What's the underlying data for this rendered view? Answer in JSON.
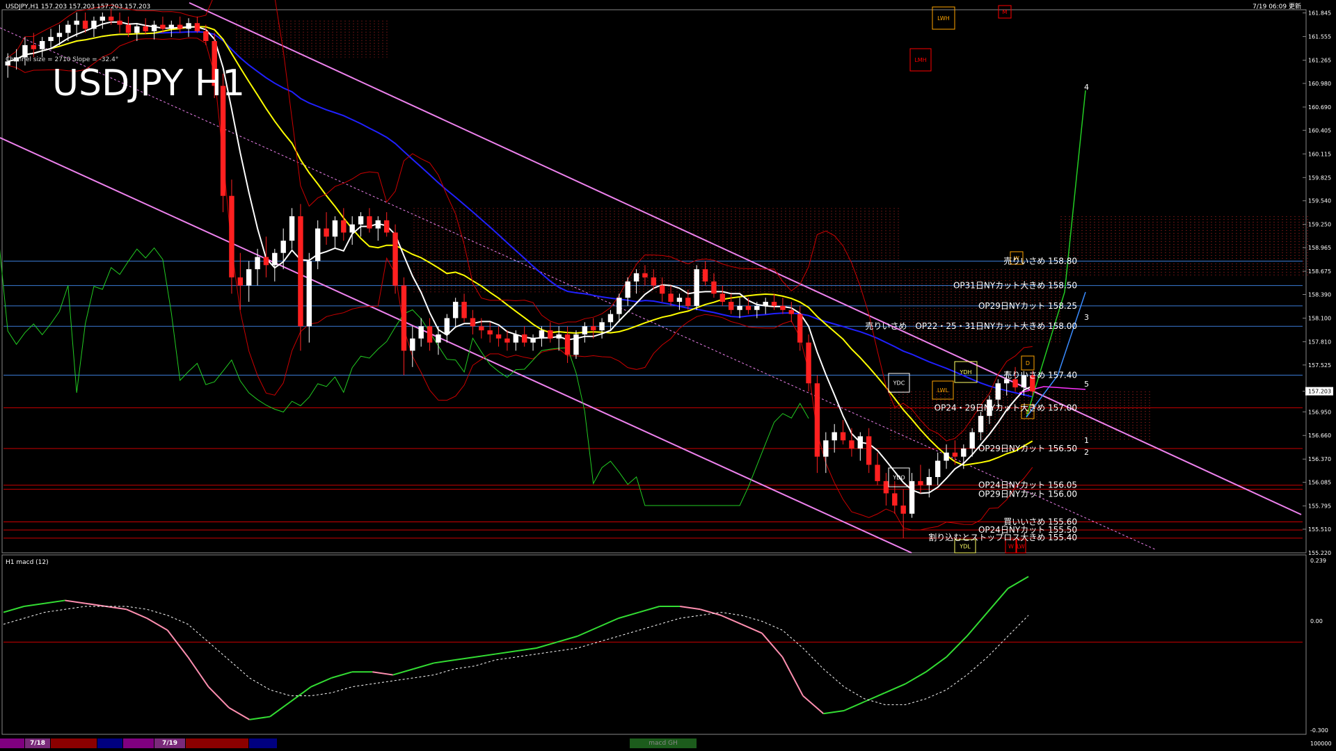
{
  "header": {
    "symbol_info": "USDJPY,H1  157.203 157.203 157.203 157.203",
    "server_time": "7/19 06:09 更新",
    "big_title": "USDJPY H1",
    "channel_info": "Channel size = 2710 Slope = -32.4°"
  },
  "colors": {
    "bull": "#ffffff",
    "bear": "#ff2020",
    "channel": "#ee82ee",
    "kumo": "#ff3030",
    "ma_white": "#ffffff",
    "ma_yellow": "#ffff00",
    "ma_blue": "#2020ff",
    "macd_main": "#33dd33",
    "macd_signal": "#ffffff",
    "level_blue": "#3a7bd5",
    "level_red": "#cc0000"
  },
  "price_axis": {
    "ticks": [
      "161.845",
      "161.555",
      "161.265",
      "160.980",
      "160.690",
      "160.405",
      "160.115",
      "159.825",
      "159.540",
      "159.250",
      "158.965",
      "158.675",
      "158.390",
      "158.100",
      "157.810",
      "157.525",
      "157.203",
      "156.950",
      "156.660",
      "156.370",
      "156.085",
      "155.795",
      "155.510",
      "155.220"
    ],
    "current": "157.203"
  },
  "level_labels": [
    "売りいさめ 158.80",
    "OP31日NYカット大きめ 158.50",
    "OP29日NYカット 158.25",
    "売りいさめ　OP22・25・31日NYカット大きめ 158.00",
    "売りいさめ 157.40",
    "OP24・29日NYカット大きめ 157.00",
    "OP29日NYカット 156.50",
    "OP24日NYカット 156.05",
    "OP29日NYカット 156.00",
    "買いいさめ 155.60",
    "OP24日NYカット 155.50",
    "割り込むとストップロス大きめ 155.40"
  ],
  "box_labels": [
    "LWH",
    "M",
    "LMH",
    "YDC",
    "YDH",
    "LWL",
    "D",
    "D",
    "YDO",
    "YDL",
    "W",
    "W",
    "LW"
  ],
  "wave_labels": [
    "4",
    "3",
    "5",
    "1",
    "2"
  ],
  "macd": {
    "title": "H1  macd (12)",
    "scale_top": "0.239",
    "scale_zero": "0.00",
    "scale_bottom": "-0.300",
    "footer": "100000"
  },
  "date_tabs": [
    "7/18",
    "7/19"
  ],
  "bottom_label": "macd GH",
  "chart_data": {
    "type": "candlestick",
    "symbol": "USDJPY",
    "timeframe": "H1",
    "ylim": [
      155.22,
      161.85
    ],
    "candles": [
      [
        161.2,
        161.35,
        161.05,
        161.25
      ],
      [
        161.25,
        161.4,
        161.15,
        161.3
      ],
      [
        161.3,
        161.55,
        161.2,
        161.45
      ],
      [
        161.45,
        161.6,
        161.3,
        161.4
      ],
      [
        161.4,
        161.55,
        161.3,
        161.5
      ],
      [
        161.5,
        161.65,
        161.4,
        161.55
      ],
      [
        161.55,
        161.7,
        161.45,
        161.6
      ],
      [
        161.6,
        161.75,
        161.5,
        161.7
      ],
      [
        161.7,
        161.85,
        161.55,
        161.75
      ],
      [
        161.75,
        161.85,
        161.6,
        161.65
      ],
      [
        161.65,
        161.8,
        161.55,
        161.75
      ],
      [
        161.75,
        161.85,
        161.65,
        161.8
      ],
      [
        161.8,
        161.9,
        161.7,
        161.75
      ],
      [
        161.75,
        161.85,
        161.6,
        161.7
      ],
      [
        161.7,
        161.8,
        161.55,
        161.6
      ],
      [
        161.6,
        161.72,
        161.5,
        161.68
      ],
      [
        161.68,
        161.78,
        161.58,
        161.62
      ],
      [
        161.62,
        161.75,
        161.52,
        161.7
      ],
      [
        161.7,
        161.8,
        161.6,
        161.65
      ],
      [
        161.65,
        161.75,
        161.55,
        161.7
      ],
      [
        161.7,
        161.8,
        161.6,
        161.65
      ],
      [
        161.65,
        161.78,
        161.55,
        161.72
      ],
      [
        161.72,
        161.8,
        161.6,
        161.62
      ],
      [
        161.62,
        161.7,
        161.45,
        161.5
      ],
      [
        161.5,
        161.6,
        160.8,
        160.95
      ],
      [
        160.95,
        161.1,
        159.4,
        159.6
      ],
      [
        159.6,
        159.8,
        158.4,
        158.6
      ],
      [
        158.6,
        158.9,
        158.2,
        158.5
      ],
      [
        158.5,
        158.8,
        158.3,
        158.7
      ],
      [
        158.7,
        158.95,
        158.5,
        158.85
      ],
      [
        158.85,
        159.1,
        158.6,
        158.75
      ],
      [
        158.75,
        158.95,
        158.55,
        158.9
      ],
      [
        158.9,
        159.2,
        158.7,
        159.05
      ],
      [
        159.05,
        159.45,
        158.95,
        159.35
      ],
      [
        159.35,
        159.5,
        157.7,
        158.0
      ],
      [
        158.0,
        158.9,
        157.8,
        158.8
      ],
      [
        158.8,
        159.3,
        158.7,
        159.2
      ],
      [
        159.2,
        159.4,
        159.0,
        159.1
      ],
      [
        159.1,
        159.35,
        158.95,
        159.3
      ],
      [
        159.3,
        159.45,
        159.05,
        159.15
      ],
      [
        159.15,
        159.35,
        159.0,
        159.25
      ],
      [
        159.25,
        159.4,
        159.1,
        159.35
      ],
      [
        159.35,
        159.45,
        159.15,
        159.2
      ],
      [
        159.2,
        159.35,
        159.05,
        159.3
      ],
      [
        159.3,
        159.4,
        159.1,
        159.15
      ],
      [
        159.15,
        159.25,
        158.4,
        158.5
      ],
      [
        158.5,
        158.6,
        157.4,
        157.7
      ],
      [
        157.7,
        158.0,
        157.5,
        157.85
      ],
      [
        157.85,
        158.1,
        157.75,
        158.0
      ],
      [
        158.0,
        158.1,
        157.7,
        157.8
      ],
      [
        157.8,
        158.0,
        157.65,
        157.9
      ],
      [
        157.9,
        158.15,
        157.8,
        158.1
      ],
      [
        158.1,
        158.35,
        158.0,
        158.3
      ],
      [
        158.3,
        158.4,
        158.05,
        158.1
      ],
      [
        158.1,
        158.2,
        157.9,
        158.0
      ],
      [
        158.0,
        158.1,
        157.85,
        157.95
      ],
      [
        157.95,
        158.05,
        157.8,
        157.9
      ],
      [
        157.9,
        158.0,
        157.75,
        157.85
      ],
      [
        157.85,
        157.95,
        157.7,
        157.8
      ],
      [
        157.8,
        157.95,
        157.7,
        157.9
      ],
      [
        157.9,
        158.0,
        157.75,
        157.8
      ],
      [
        157.8,
        157.9,
        157.7,
        157.85
      ],
      [
        157.85,
        158.0,
        157.75,
        157.95
      ],
      [
        157.95,
        158.05,
        157.8,
        157.85
      ],
      [
        157.85,
        158.0,
        157.7,
        157.9
      ],
      [
        157.9,
        158.0,
        157.55,
        157.65
      ],
      [
        157.65,
        157.95,
        157.6,
        157.9
      ],
      [
        157.9,
        158.05,
        157.8,
        158.0
      ],
      [
        158.0,
        158.1,
        157.85,
        157.95
      ],
      [
        157.95,
        158.1,
        157.85,
        158.05
      ],
      [
        158.05,
        158.2,
        157.95,
        158.15
      ],
      [
        158.15,
        158.4,
        158.05,
        158.35
      ],
      [
        158.35,
        158.6,
        158.25,
        158.55
      ],
      [
        158.55,
        158.7,
        158.4,
        158.65
      ],
      [
        158.65,
        158.75,
        158.5,
        158.6
      ],
      [
        158.6,
        158.7,
        158.45,
        158.5
      ],
      [
        158.5,
        158.6,
        158.3,
        158.4
      ],
      [
        158.4,
        158.5,
        158.25,
        158.3
      ],
      [
        158.3,
        158.4,
        158.2,
        158.35
      ],
      [
        158.35,
        158.45,
        158.2,
        158.25
      ],
      [
        158.25,
        158.75,
        158.2,
        158.7
      ],
      [
        158.7,
        158.8,
        158.5,
        158.55
      ],
      [
        158.55,
        158.65,
        158.35,
        158.4
      ],
      [
        158.4,
        158.5,
        158.25,
        158.3
      ],
      [
        158.3,
        158.4,
        158.15,
        158.2
      ],
      [
        158.2,
        158.35,
        158.1,
        158.25
      ],
      [
        158.25,
        158.35,
        158.15,
        158.2
      ],
      [
        158.2,
        158.3,
        158.1,
        158.25
      ],
      [
        158.25,
        158.35,
        158.15,
        158.3
      ],
      [
        158.3,
        158.4,
        158.2,
        158.25
      ],
      [
        158.25,
        158.35,
        158.15,
        158.2
      ],
      [
        158.2,
        158.3,
        158.05,
        158.15
      ],
      [
        158.15,
        158.25,
        157.7,
        157.8
      ],
      [
        157.8,
        157.9,
        157.2,
        157.3
      ],
      [
        157.3,
        157.4,
        156.2,
        156.4
      ],
      [
        156.4,
        156.7,
        156.2,
        156.6
      ],
      [
        156.6,
        156.8,
        156.45,
        156.7
      ],
      [
        156.7,
        156.85,
        156.55,
        156.6
      ],
      [
        156.6,
        156.75,
        156.4,
        156.5
      ],
      [
        156.5,
        156.7,
        156.35,
        156.65
      ],
      [
        156.65,
        156.75,
        156.2,
        156.3
      ],
      [
        156.3,
        156.45,
        156.05,
        156.1
      ],
      [
        156.1,
        156.2,
        155.8,
        155.95
      ],
      [
        155.95,
        156.1,
        155.7,
        155.8
      ],
      [
        155.8,
        156.0,
        155.4,
        155.7
      ],
      [
        155.7,
        156.2,
        155.65,
        156.1
      ],
      [
        156.1,
        156.3,
        155.95,
        156.05
      ],
      [
        156.05,
        156.25,
        155.9,
        156.15
      ],
      [
        156.15,
        156.45,
        156.05,
        156.35
      ],
      [
        156.35,
        156.55,
        156.25,
        156.45
      ],
      [
        156.45,
        156.6,
        156.3,
        156.4
      ],
      [
        156.4,
        156.55,
        156.25,
        156.5
      ],
      [
        156.5,
        156.75,
        156.4,
        156.7
      ],
      [
        156.7,
        156.95,
        156.6,
        156.9
      ],
      [
        156.9,
        157.15,
        156.8,
        157.1
      ],
      [
        157.1,
        157.35,
        157.0,
        157.3
      ],
      [
        157.3,
        157.45,
        157.15,
        157.35
      ],
      [
        157.35,
        157.5,
        157.2,
        157.25
      ],
      [
        157.25,
        157.45,
        157.15,
        157.4
      ],
      [
        157.4,
        157.45,
        157.15,
        157.2
      ]
    ],
    "levels": [
      {
        "price": 158.8,
        "color": "#3a7bd5"
      },
      {
        "price": 158.5,
        "color": "#3a7bd5"
      },
      {
        "price": 158.25,
        "color": "#3a7bd5"
      },
      {
        "price": 158.0,
        "color": "#3a7bd5"
      },
      {
        "price": 157.4,
        "color": "#3a7bd5"
      },
      {
        "price": 157.0,
        "color": "#cc0000"
      },
      {
        "price": 156.5,
        "color": "#cc0000"
      },
      {
        "price": 156.05,
        "color": "#cc0000"
      },
      {
        "price": 156.0,
        "color": "#cc0000"
      },
      {
        "price": 155.6,
        "color": "#cc0000"
      },
      {
        "price": 155.5,
        "color": "#cc0000"
      },
      {
        "price": 155.4,
        "color": "#cc0000"
      }
    ],
    "macd_main": [
      0.1,
      0.12,
      0.13,
      0.14,
      0.13,
      0.12,
      0.11,
      0.08,
      0.04,
      -0.05,
      -0.15,
      -0.22,
      -0.26,
      -0.25,
      -0.2,
      -0.15,
      -0.12,
      -0.1,
      -0.1,
      -0.11,
      -0.09,
      -0.07,
      -0.06,
      -0.05,
      -0.04,
      -0.03,
      -0.02,
      0.0,
      0.02,
      0.05,
      0.08,
      0.1,
      0.12,
      0.12,
      0.11,
      0.09,
      0.06,
      0.03,
      -0.05,
      -0.18,
      -0.24,
      -0.23,
      -0.2,
      -0.17,
      -0.14,
      -0.1,
      -0.05,
      0.02,
      0.1,
      0.18,
      0.22
    ],
    "macd_signal": [
      0.06,
      0.08,
      0.1,
      0.11,
      0.12,
      0.12,
      0.12,
      0.11,
      0.09,
      0.06,
      0.0,
      -0.06,
      -0.12,
      -0.16,
      -0.18,
      -0.18,
      -0.17,
      -0.15,
      -0.14,
      -0.13,
      -0.12,
      -0.11,
      -0.09,
      -0.08,
      -0.06,
      -0.05,
      -0.04,
      -0.03,
      -0.02,
      0.0,
      0.02,
      0.04,
      0.06,
      0.08,
      0.09,
      0.1,
      0.09,
      0.07,
      0.04,
      -0.02,
      -0.09,
      -0.15,
      -0.19,
      -0.21,
      -0.21,
      -0.19,
      -0.16,
      -0.11,
      -0.05,
      0.02,
      0.09
    ],
    "macd_ylim": [
      -0.3,
      0.26
    ]
  }
}
